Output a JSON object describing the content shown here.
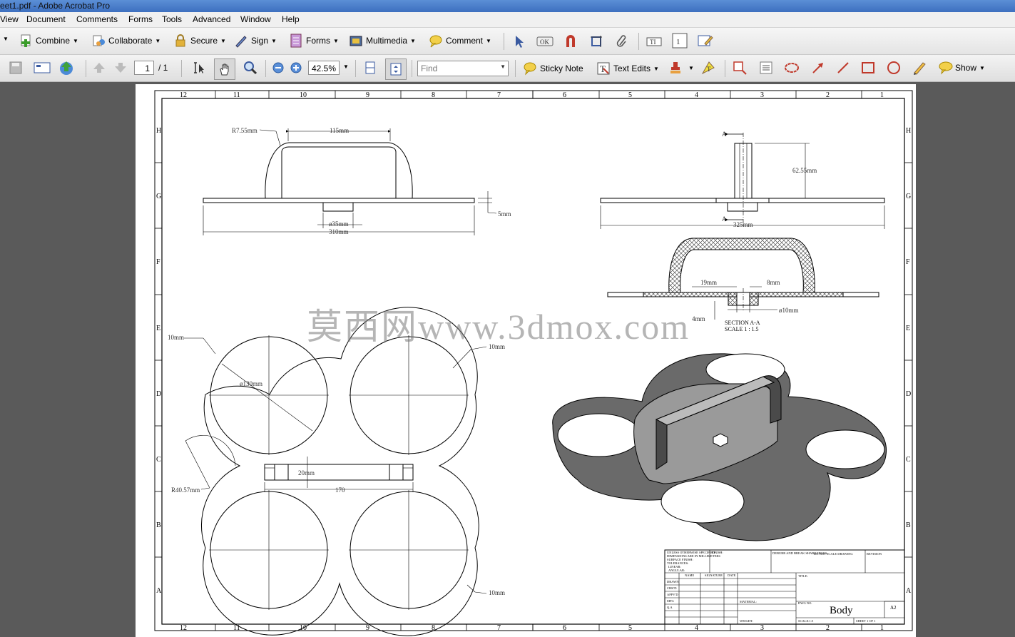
{
  "window": {
    "title": "eet1.pdf - Adobe Acrobat Pro"
  },
  "menu": [
    "View",
    "Document",
    "Comments",
    "Forms",
    "Tools",
    "Advanced",
    "Window",
    "Help"
  ],
  "toolbar1": {
    "combine": "Combine",
    "collaborate": "Collaborate",
    "secure": "Secure",
    "sign": "Sign",
    "forms": "Forms",
    "multimedia": "Multimedia",
    "comment": "Comment"
  },
  "toolbar2": {
    "page_current": "1",
    "page_total": "/ 1",
    "zoom": "42.5%",
    "find_placeholder": "Find",
    "sticky_note": "Sticky Note",
    "text_edits": "Text Edits",
    "show": "Show"
  },
  "drawing": {
    "columns": [
      "12",
      "11",
      "10",
      "9",
      "8",
      "7",
      "6",
      "5",
      "4",
      "3",
      "2",
      "1"
    ],
    "rows": [
      "H",
      "G",
      "F",
      "E",
      "D",
      "C",
      "B",
      "A"
    ],
    "dims": {
      "r755": "R7.55mm",
      "d115": "115mm",
      "d5": "5mm",
      "d35": "ø35mm",
      "d310": "310mm",
      "d6255": "62.55mm",
      "d325": "325mm",
      "d19": "19mm",
      "d8": "8mm",
      "d10dia": "ø10mm",
      "d4": "4mm",
      "sectionA": "A",
      "section_title": "SECTION A-A",
      "section_scale": "SCALE 1 : 1.5",
      "d10a": "10mm",
      "d10b": "10mm",
      "d10c": "10mm",
      "d130": "ø130mm",
      "d20": "20mm",
      "d170": "170",
      "r4057": "R40.57mm"
    },
    "titleblock": {
      "unless": "UNLESS OTHERWISE SPECIFIED:",
      "dims_in": "DIMENSIONS ARE IN MILLIMETERS",
      "surface": "SURFACE FINISH:",
      "tolerances": "TOLERANCES:",
      "linear": "LINEAR:",
      "angular": "ANGULAR:",
      "finish": "FINISH:",
      "deburr": "DEBURR AND BREAK SHARP EDGES",
      "donotscale": "DO NOT SCALE DRAWING",
      "revision": "REVISION",
      "name": "NAME",
      "signature": "SIGNATURE",
      "date": "DATE",
      "title": "TITLE:",
      "drawn": "DRAWN",
      "chk": "CHK'D",
      "appvd": "APPV'D",
      "mfg": "MFG",
      "qa": "Q.A",
      "material": "MATERIAL:",
      "weight": "WEIGHT:",
      "dwgno": "DWG NO.",
      "part_name": "Body",
      "size": "A2",
      "scale": "SCALE:1:5",
      "sheet": "SHEET 1 OF 1"
    }
  },
  "watermark": "莫西网www.3dmox.com",
  "colors": {
    "accent": "#3d6fbf",
    "toolbar": "#e8e8e8",
    "background": "#5a5a5a"
  }
}
